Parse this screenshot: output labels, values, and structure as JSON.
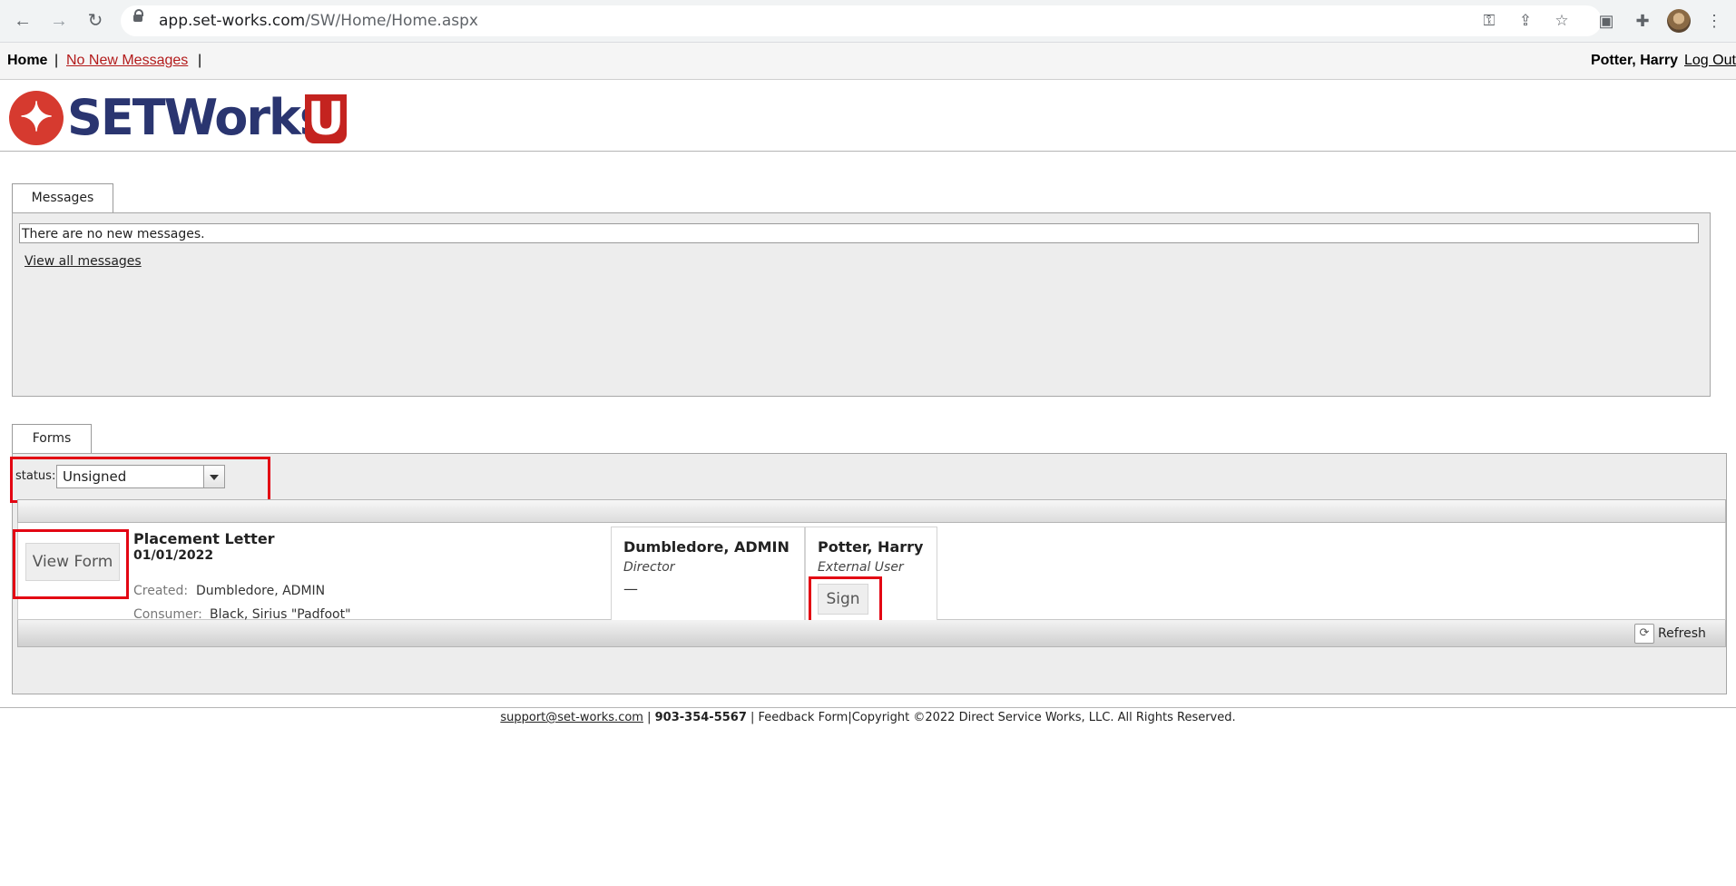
{
  "browser": {
    "url_domain": "app.set-works.com",
    "url_path": "/SW/Home/Home.aspx"
  },
  "topnav": {
    "home_label": "Home",
    "separator": "|",
    "messages_link": "No New Messages",
    "user_name": "Potter, Harry",
    "logout_label": "Log Out"
  },
  "logo": {
    "text": "SETWorks",
    "u_letter": "U"
  },
  "messages": {
    "tab_label": "Messages",
    "status_text": "There are no new messages.",
    "view_all_link": "View all messages"
  },
  "forms": {
    "tab_label": "Forms",
    "status_label": "status:",
    "status_selected": "Unsigned",
    "rows": [
      {
        "view_button": "View Form",
        "title": "Placement Letter",
        "date": "01/01/2022",
        "created_label": "Created:",
        "created_value": "Dumbledore, ADMIN",
        "consumer_label": "Consumer:",
        "consumer_value": "Black, Sirius \"Padfoot\"",
        "signers": [
          {
            "name": "Dumbledore, ADMIN",
            "role": "Director",
            "status": "—"
          },
          {
            "name": "Potter, Harry",
            "role": "External User",
            "action": "Sign"
          }
        ]
      }
    ],
    "refresh_label": "Refresh"
  },
  "footer": {
    "email": "support@set-works.com",
    "sep1": " | ",
    "phone": "903-354-5567",
    "sep2": " | ",
    "feedback": "Feedback Form",
    "sep3": "|",
    "copyright": "Copyright ©2022 Direct Service Works, LLC. All Rights Reserved."
  },
  "colors": {
    "highlight": "#e30613",
    "brand_red": "#d63a2f",
    "brand_navy": "#2a3570",
    "link_red": "#b31b1b"
  },
  "icons": {
    "back": "back-arrow-icon",
    "forward": "forward-arrow-icon",
    "reload": "reload-icon",
    "lock": "lock-icon",
    "key": "key-icon",
    "share": "share-icon",
    "star": "bookmark-star-icon",
    "reading": "reading-list-icon",
    "extensions": "puzzle-icon",
    "menu": "kebab-menu-icon",
    "refresh": "refresh-icon",
    "dropdown": "dropdown-arrow-icon"
  }
}
